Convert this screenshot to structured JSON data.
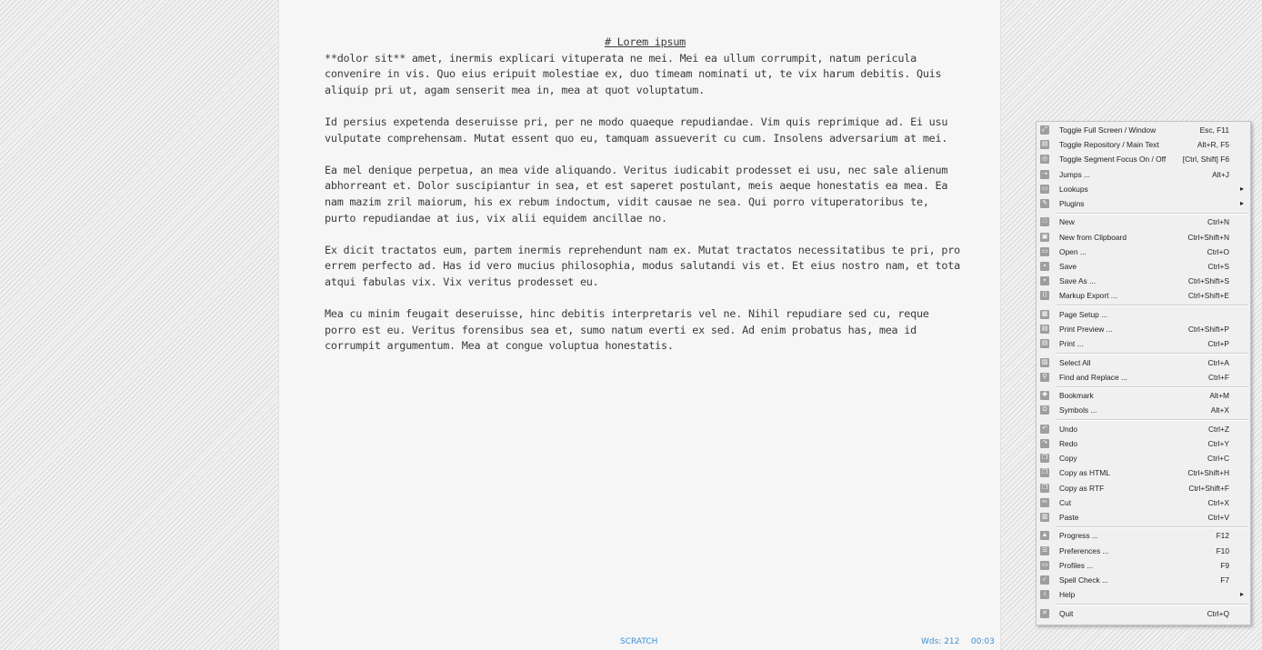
{
  "editor": {
    "heading": "# Lorem ipsum",
    "paragraphs": [
      "**dolor sit** amet, inermis explicari vituperata ne mei. Mei ea ullum corrumpit, natum pericula convenire in vis. Quo eius eripuit molestiae ex, duo timeam nominati ut, te vix harum debitis. Quis aliquip pri ut, agam senserit mea in, mea at quot voluptatum.",
      "Id persius expetenda deseruisse pri, per ne modo quaeque repudiandae. Vim quis reprimique ad. Ei usu vulputate comprehensam. Mutat essent quo eu, tamquam assueverit cu cum. Insolens adversarium at mei.",
      "Ea mel denique perpetua, an mea vide aliquando. Veritus iudicabit prodesset ei usu, nec sale alienum abhorreant et. Dolor suscipiantur in sea, et est saperet postulant, meis aeque honestatis ea mea. Ea nam mazim zril maiorum, his ex rebum indoctum, vidit causae ne sea. Qui porro vituperatoribus te, purto repudiandae at ius, vix alii equidem ancillae no.",
      "Ex dicit tractatos eum, partem inermis reprehendunt nam ex. Mutat tractatos necessitatibus te pri, pro errem perfecto ad. Has id vero mucius philosophia, modus salutandi vis et. Et eius nostro nam, et tota atqui fabulas vix. Vix veritus prodesset eu.",
      "Mea cu minim feugait deseruisse, hinc debitis interpretaris vel ne. Nihil repudiare sed cu, reque porro est eu. Veritus forensibus sea et, sumo natum everti ex sed. Ad enim probatus has, mea id corrumpit argumentum. Mea at congue voluptua honestatis."
    ]
  },
  "status": {
    "mode": "SCRATCH",
    "word_count": "Wds: 212",
    "time": "00:03",
    "color": "#3b8fd4"
  },
  "menu": {
    "items": [
      {
        "label": "Toggle Full Screen / Window",
        "shortcut": "Esc, F11",
        "icon": "fullscreen-icon"
      },
      {
        "label": "Toggle Repository / Main Text",
        "shortcut": "Alt+R, F5",
        "icon": "repository-icon"
      },
      {
        "label": "Toggle Segment Focus On / Off",
        "shortcut": "[Ctrl, Shift] F6",
        "icon": "segment-focus-icon"
      },
      {
        "label": "Jumps ...",
        "shortcut": "Alt+J",
        "icon": "jumps-icon"
      },
      {
        "label": "Lookups",
        "shortcut": "",
        "icon": "lookups-icon",
        "submenu": true
      },
      {
        "label": "Plugins",
        "shortcut": "",
        "icon": "plugins-icon",
        "submenu": true
      },
      {
        "label": "New",
        "shortcut": "Ctrl+N",
        "icon": "new-document-icon"
      },
      {
        "label": "New from Clipboard",
        "shortcut": "Ctrl+Shift+N",
        "icon": "new-from-clipboard-icon"
      },
      {
        "label": "Open ...",
        "shortcut": "Ctrl+O",
        "icon": "open-icon"
      },
      {
        "label": "Save",
        "shortcut": "Ctrl+S",
        "icon": "save-icon"
      },
      {
        "label": "Save As ...",
        "shortcut": "Ctrl+Shift+S",
        "icon": "save-as-icon"
      },
      {
        "label": "Markup Export ...",
        "shortcut": "Ctrl+Shift+E",
        "icon": "markup-export-icon"
      },
      {
        "label": "Page Setup ...",
        "shortcut": "",
        "icon": "page-setup-icon"
      },
      {
        "label": "Print Preview ...",
        "shortcut": "Ctrl+Shift+P",
        "icon": "print-preview-icon"
      },
      {
        "label": "Print ...",
        "shortcut": "Ctrl+P",
        "icon": "print-icon"
      },
      {
        "label": "Select All",
        "shortcut": "Ctrl+A",
        "icon": "select-all-icon"
      },
      {
        "label": "Find and Replace ...",
        "shortcut": "Ctrl+F",
        "icon": "find-replace-icon"
      },
      {
        "label": "Bookmark",
        "shortcut": "Alt+M",
        "icon": "bookmark-icon"
      },
      {
        "label": "Symbols ...",
        "shortcut": "Alt+X",
        "icon": "symbols-icon"
      },
      {
        "label": "Undo",
        "shortcut": "Ctrl+Z",
        "icon": "undo-icon"
      },
      {
        "label": "Redo",
        "shortcut": "Ctrl+Y",
        "icon": "redo-icon"
      },
      {
        "label": "Copy",
        "shortcut": "Ctrl+C",
        "icon": "copy-icon"
      },
      {
        "label": "Copy as HTML",
        "shortcut": "Ctrl+Shift+H",
        "icon": "copy-html-icon"
      },
      {
        "label": "Copy as RTF",
        "shortcut": "Ctrl+Shift+F",
        "icon": "copy-rtf-icon"
      },
      {
        "label": "Cut",
        "shortcut": "Ctrl+X",
        "icon": "cut-icon"
      },
      {
        "label": "Paste",
        "shortcut": "Ctrl+V",
        "icon": "paste-icon"
      },
      {
        "label": "Progress ...",
        "shortcut": "F12",
        "icon": "progress-icon"
      },
      {
        "label": "Preferences ...",
        "shortcut": "F10",
        "icon": "preferences-icon"
      },
      {
        "label": "Profiles ...",
        "shortcut": "F9",
        "icon": "profiles-icon"
      },
      {
        "label": "Spell Check ...",
        "shortcut": "F7",
        "icon": "spell-check-icon"
      },
      {
        "label": "Help",
        "shortcut": "",
        "icon": "help-icon",
        "submenu": true
      },
      {
        "label": "Quit",
        "shortcut": "Ctrl+Q",
        "icon": "quit-icon"
      }
    ]
  }
}
